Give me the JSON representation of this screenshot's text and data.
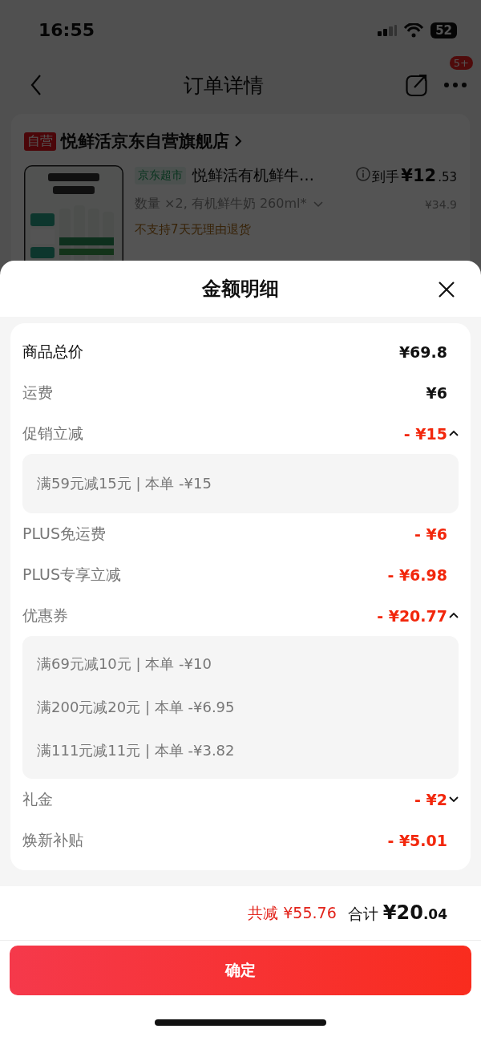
{
  "status_bar": {
    "time": "16:55",
    "battery": "52"
  },
  "nav": {
    "title": "订单详情",
    "badge": "5+"
  },
  "store": {
    "badge": "自营",
    "name": "悦鲜活京东自营旗舰店"
  },
  "product": {
    "tag": "京东超市",
    "title": "悦鲜活有机鲜牛…",
    "price_label": "到手",
    "price_int": "¥12",
    "price_dec": ".53",
    "spec": "数量 ×2, 有机鲜牛奶 260ml*",
    "original_price": "¥34.9",
    "notice": "不支持7天无理由退货"
  },
  "sheet": {
    "title": "金额明细",
    "rows": [
      {
        "kind": "total",
        "label": "商品总价",
        "amount": "¥69.8"
      },
      {
        "kind": "fee",
        "label": "运费",
        "amount": "¥6"
      },
      {
        "kind": "discount",
        "label": "促销立减",
        "amount": "- ¥15",
        "expanded": true,
        "details": [
          "满59元减15元 | 本单 -¥15"
        ]
      },
      {
        "kind": "discount",
        "label": "PLUS免运费",
        "amount": "- ¥6"
      },
      {
        "kind": "discount",
        "label": "PLUS专享立减",
        "amount": "- ¥6.98"
      },
      {
        "kind": "discount",
        "label": "优惠券",
        "amount": "- ¥20.77",
        "expanded": true,
        "details": [
          "满69元减10元 | 本单 -¥10",
          "满200元减20元 | 本单 -¥6.95",
          "满111元减11元 | 本单 -¥3.82"
        ]
      },
      {
        "kind": "discount",
        "label": "礼金",
        "amount": "- ¥2",
        "expanded": false
      },
      {
        "kind": "discount",
        "label": "焕新补贴",
        "amount": "- ¥5.01"
      }
    ],
    "saved": "共减 ¥55.76",
    "total_label": "合计",
    "total_int": "¥20",
    "total_dec": ".04",
    "confirm": "确定"
  }
}
